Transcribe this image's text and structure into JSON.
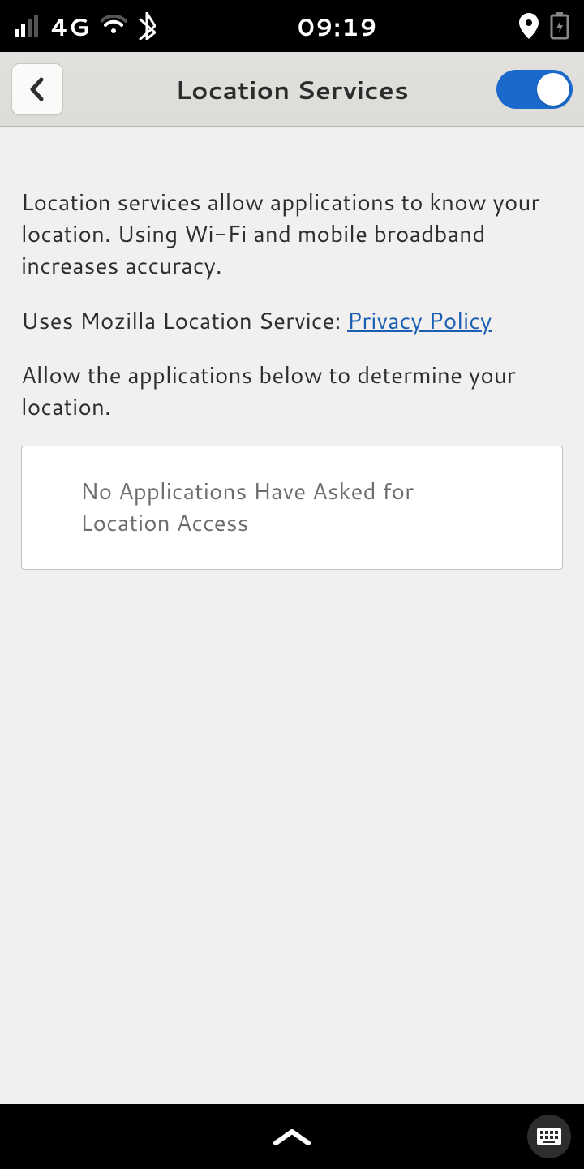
{
  "statusbar": {
    "network_type": "4G",
    "time": "09:19"
  },
  "header": {
    "title": "Location Services"
  },
  "content": {
    "description": "Location services allow applications to know your location. Using Wi-Fi and mobile broadband increases accuracy.",
    "uses_prefix": "Uses Mozilla Location Service: ",
    "privacy_link": "Privacy Policy",
    "allow_text": "Allow the applications below to determine your location.",
    "no_apps": "No Applications Have Asked for Location Access"
  }
}
